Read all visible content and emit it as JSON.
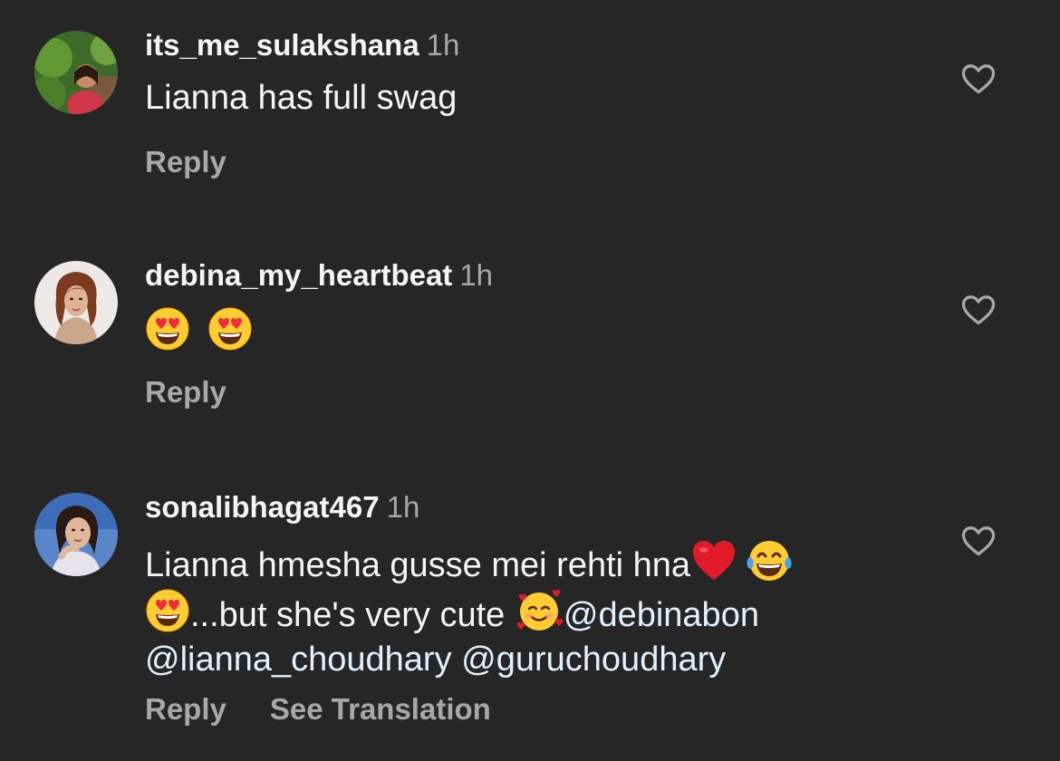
{
  "comments": [
    {
      "username": "its_me_sulakshana",
      "time": "1h",
      "text": "Lianna has full swag",
      "reply_label": "Reply",
      "like_icon": "heart-outline-icon"
    },
    {
      "username": "debina_my_heartbeat",
      "time": "1h",
      "emojis": [
        "heart-eyes",
        "heart-eyes"
      ],
      "reply_label": "Reply",
      "like_icon": "heart-outline-icon"
    },
    {
      "username": "sonalibhagat467",
      "time": "1h",
      "text_part1": "Lianna hmesha gusse mei rehti hna",
      "text_part2": "...but she's very cute ",
      "mentions": [
        "@debinabon",
        "@lianna_choudhary",
        "@guruchoudhary"
      ],
      "emojis": [
        "red-heart",
        "tears-of-joy",
        "heart-eyes",
        "smiling-face-with-hearts"
      ],
      "reply_label": "Reply",
      "see_translation_label": "See Translation",
      "like_icon": "heart-outline-icon"
    }
  ],
  "colors": {
    "background": "#262626",
    "primary_text": "#f5f5f5",
    "secondary_text": "#a8a8a8",
    "mention": "#e0f1ff"
  }
}
